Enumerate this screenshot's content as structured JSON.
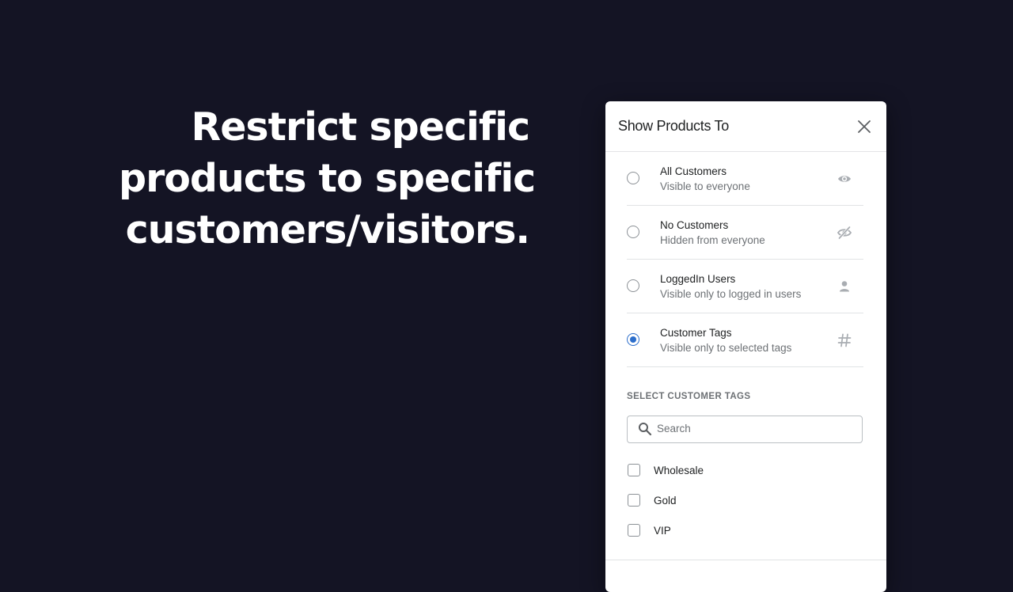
{
  "headline": {
    "lines": [
      "Restrict specific",
      "products to specific",
      "customers/visitors."
    ]
  },
  "modal": {
    "title": "Show Products To",
    "options": [
      {
        "title": "All Customers",
        "subtitle": "Visible to everyone",
        "icon": "eye-icon",
        "selected": false
      },
      {
        "title": "No Customers",
        "subtitle": "Hidden from everyone",
        "icon": "eye-off-icon",
        "selected": false
      },
      {
        "title": "LoggedIn Users",
        "subtitle": "Visible only to logged in users",
        "icon": "person-icon",
        "selected": false
      },
      {
        "title": "Customer Tags",
        "subtitle": "Visible only to selected tags",
        "icon": "hashtag-icon",
        "selected": true
      }
    ],
    "tags_section": {
      "label": "SELECT CUSTOMER TAGS",
      "search_placeholder": "Search",
      "search_value": "",
      "tags": [
        {
          "label": "Wholesale",
          "checked": false
        },
        {
          "label": "Gold",
          "checked": false
        },
        {
          "label": "VIP",
          "checked": false
        }
      ]
    }
  },
  "colors": {
    "background": "#141424",
    "accent": "#2c6ecb",
    "icon_gray": "#a9adb2"
  }
}
